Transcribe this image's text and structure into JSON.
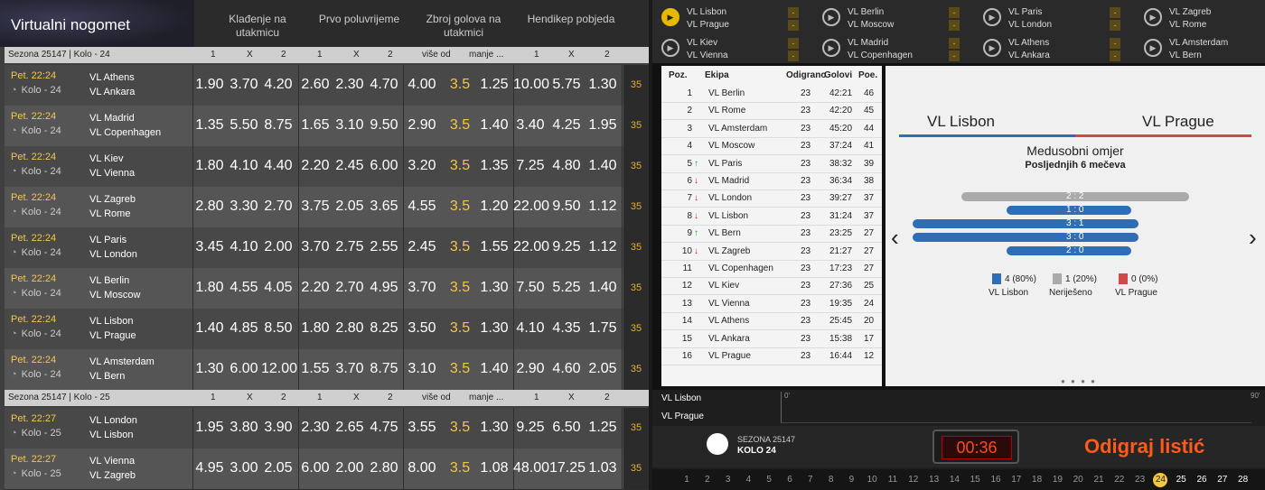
{
  "left": {
    "brand": "Virtualni nogomet",
    "markets": [
      "Klađenje na utakmicu",
      "Prvo poluvrijeme",
      "Zbroj golova na utakmici",
      "Hendikep pobjeda"
    ],
    "col_headers": [
      "1",
      "X",
      "2",
      "1",
      "X",
      "2",
      "više od",
      "manje ...",
      "1",
      "X",
      "2"
    ],
    "seasons": [
      {
        "label": "Sezona 25147 | Kolo - 24",
        "rows": [
          {
            "time": "Pet. 22:24",
            "round": "Kolo - 24",
            "home": "VL Athens",
            "away": "VL Ankara",
            "odds": [
              "1.90",
              "3.70",
              "4.20",
              "2.60",
              "2.30",
              "4.70",
              "4.00",
              "3.5",
              "1.25",
              "10.00",
              "5.75",
              "1.30"
            ],
            "more": "35"
          },
          {
            "time": "Pet. 22:24",
            "round": "Kolo - 24",
            "home": "VL Madrid",
            "away": "VL Copenhagen",
            "odds": [
              "1.35",
              "5.50",
              "8.75",
              "1.65",
              "3.10",
              "9.50",
              "2.90",
              "3.5",
              "1.40",
              "3.40",
              "4.25",
              "1.95"
            ],
            "more": "35"
          },
          {
            "time": "Pet. 22:24",
            "round": "Kolo - 24",
            "home": "VL Kiev",
            "away": "VL Vienna",
            "odds": [
              "1.80",
              "4.10",
              "4.40",
              "2.20",
              "2.45",
              "6.00",
              "3.20",
              "3.5",
              "1.35",
              "7.25",
              "4.80",
              "1.40"
            ],
            "more": "35"
          },
          {
            "time": "Pet. 22:24",
            "round": "Kolo - 24",
            "home": "VL Zagreb",
            "away": "VL Rome",
            "odds": [
              "2.80",
              "3.30",
              "2.70",
              "3.75",
              "2.05",
              "3.65",
              "4.55",
              "3.5",
              "1.20",
              "22.00",
              "9.50",
              "1.12"
            ],
            "more": "35"
          },
          {
            "time": "Pet. 22:24",
            "round": "Kolo - 24",
            "home": "VL Paris",
            "away": "VL London",
            "odds": [
              "3.45",
              "4.10",
              "2.00",
              "3.70",
              "2.75",
              "2.55",
              "2.45",
              "3.5",
              "1.55",
              "22.00",
              "9.25",
              "1.12"
            ],
            "more": "35"
          },
          {
            "time": "Pet. 22:24",
            "round": "Kolo - 24",
            "home": "VL Berlin",
            "away": "VL Moscow",
            "odds": [
              "1.80",
              "4.55",
              "4.05",
              "2.20",
              "2.70",
              "4.95",
              "3.70",
              "3.5",
              "1.30",
              "7.50",
              "5.25",
              "1.40"
            ],
            "more": "35"
          },
          {
            "time": "Pet. 22:24",
            "round": "Kolo - 24",
            "home": "VL Lisbon",
            "away": "VL Prague",
            "odds": [
              "1.40",
              "4.85",
              "8.50",
              "1.80",
              "2.80",
              "8.25",
              "3.50",
              "3.5",
              "1.30",
              "4.10",
              "4.35",
              "1.75"
            ],
            "more": "35"
          },
          {
            "time": "Pet. 22:24",
            "round": "Kolo - 24",
            "home": "VL Amsterdam",
            "away": "VL Bern",
            "odds": [
              "1.30",
              "6.00",
              "12.00",
              "1.55",
              "3.70",
              "8.75",
              "3.10",
              "3.5",
              "1.40",
              "2.90",
              "4.60",
              "2.05"
            ],
            "more": "35"
          }
        ]
      },
      {
        "label": "Sezona 25147 | Kolo - 25",
        "rows": [
          {
            "time": "Pet. 22:27",
            "round": "Kolo - 25",
            "home": "VL London",
            "away": "VL Lisbon",
            "odds": [
              "1.95",
              "3.80",
              "3.90",
              "2.30",
              "2.65",
              "4.75",
              "3.55",
              "3.5",
              "1.30",
              "9.25",
              "6.50",
              "1.25"
            ],
            "more": "35"
          },
          {
            "time": "Pet. 22:27",
            "round": "Kolo - 25",
            "home": "VL Vienna",
            "away": "VL Zagreb",
            "odds": [
              "4.95",
              "3.00",
              "2.05",
              "6.00",
              "2.00",
              "2.80",
              "8.00",
              "3.5",
              "1.08",
              "48.00",
              "17.25",
              "1.03"
            ],
            "more": "35"
          }
        ]
      }
    ]
  },
  "right": {
    "fixtures": [
      {
        "home": "VL Lisbon",
        "away": "VL Prague",
        "active": true
      },
      {
        "home": "VL Berlin",
        "away": "VL Moscow",
        "active": false
      },
      {
        "home": "VL Paris",
        "away": "VL London",
        "active": false
      },
      {
        "home": "VL Zagreb",
        "away": "VL Rome",
        "active": false
      },
      {
        "home": "VL Kiev",
        "away": "VL Vienna",
        "active": false
      },
      {
        "home": "VL Madrid",
        "away": "VL Copenhagen",
        "active": false
      },
      {
        "home": "VL Athens",
        "away": "VL Ankara",
        "active": false
      },
      {
        "home": "VL Amsterdam",
        "away": "VL Bern",
        "active": false
      }
    ],
    "fixture_dash": "-",
    "table_headers": [
      "Poz.",
      "Ekipa",
      "Odigrano",
      "Golovi",
      "Poe."
    ],
    "standings": [
      {
        "pos": "1",
        "team": "VL Berlin",
        "played": "23",
        "goals": "42:21",
        "pts": "46",
        "trend": ""
      },
      {
        "pos": "2",
        "team": "VL Rome",
        "played": "23",
        "goals": "42:20",
        "pts": "45",
        "trend": ""
      },
      {
        "pos": "3",
        "team": "VL Amsterdam",
        "played": "23",
        "goals": "45:20",
        "pts": "44",
        "trend": ""
      },
      {
        "pos": "4",
        "team": "VL Moscow",
        "played": "23",
        "goals": "37:24",
        "pts": "41",
        "trend": ""
      },
      {
        "pos": "5",
        "team": "VL Paris",
        "played": "23",
        "goals": "38:32",
        "pts": "39",
        "trend": "up"
      },
      {
        "pos": "6",
        "team": "VL Madrid",
        "played": "23",
        "goals": "36:34",
        "pts": "38",
        "trend": "down"
      },
      {
        "pos": "7",
        "team": "VL London",
        "played": "23",
        "goals": "39:27",
        "pts": "37",
        "trend": "down"
      },
      {
        "pos": "8",
        "team": "VL Lisbon",
        "played": "23",
        "goals": "31:24",
        "pts": "37",
        "trend": "down"
      },
      {
        "pos": "9",
        "team": "VL Bern",
        "played": "23",
        "goals": "23:25",
        "pts": "27",
        "trend": "up"
      },
      {
        "pos": "10",
        "team": "VL Zagreb",
        "played": "23",
        "goals": "21:27",
        "pts": "27",
        "trend": "down"
      },
      {
        "pos": "11",
        "team": "VL Copenhagen",
        "played": "23",
        "goals": "17:23",
        "pts": "27",
        "trend": ""
      },
      {
        "pos": "12",
        "team": "VL Kiev",
        "played": "23",
        "goals": "27:36",
        "pts": "25",
        "trend": ""
      },
      {
        "pos": "13",
        "team": "VL Vienna",
        "played": "23",
        "goals": "19:35",
        "pts": "24",
        "trend": ""
      },
      {
        "pos": "14",
        "team": "VL Athens",
        "played": "23",
        "goals": "25:45",
        "pts": "20",
        "trend": ""
      },
      {
        "pos": "15",
        "team": "VL Ankara",
        "played": "23",
        "goals": "15:38",
        "pts": "17",
        "trend": ""
      },
      {
        "pos": "16",
        "team": "VL Prague",
        "played": "23",
        "goals": "16:44",
        "pts": "12",
        "trend": ""
      }
    ],
    "h2h": {
      "home": "VL Lisbon",
      "away": "VL Prague",
      "title": "Medusobni omjer",
      "subtitle": "Posljednjih 6 mečeva",
      "results": [
        {
          "score": "2 : 2",
          "type": "draw"
        },
        {
          "score": "1 : 0",
          "type": "home"
        },
        {
          "score": "3 : 1",
          "type": "home"
        },
        {
          "score": "3 : 0",
          "type": "home"
        },
        {
          "score": "2 : 0",
          "type": "home"
        }
      ],
      "legend": [
        {
          "value": "4 (80%)",
          "label": "VL Lisbon",
          "color": "#2f6db5"
        },
        {
          "value": "1 (20%)",
          "label": "Neriješeno",
          "color": "#aaaaaa"
        },
        {
          "value": "0 (0%)",
          "label": "VL Prague",
          "color": "#d04848"
        }
      ],
      "nav_prev": "‹",
      "nav_next": "›"
    },
    "timeline": {
      "home": "VL Lisbon",
      "away": "VL Prague",
      "start": "0'",
      "end": "90'"
    },
    "round": {
      "season": "SEZONA 25147",
      "label": "KOLO 24"
    },
    "timer": "00:36",
    "play_label": "Odigraj listić",
    "rounds": [
      "1",
      "2",
      "3",
      "4",
      "5",
      "6",
      "7",
      "8",
      "9",
      "10",
      "11",
      "12",
      "13",
      "14",
      "15",
      "16",
      "17",
      "18",
      "19",
      "20",
      "21",
      "22",
      "23",
      "24",
      "25",
      "26",
      "27",
      "28"
    ],
    "current_round": "24",
    "colors": {
      "accent": "#f5c642",
      "home": "#2f6db5",
      "away": "#d04848",
      "play": "#ff5a1a"
    }
  }
}
